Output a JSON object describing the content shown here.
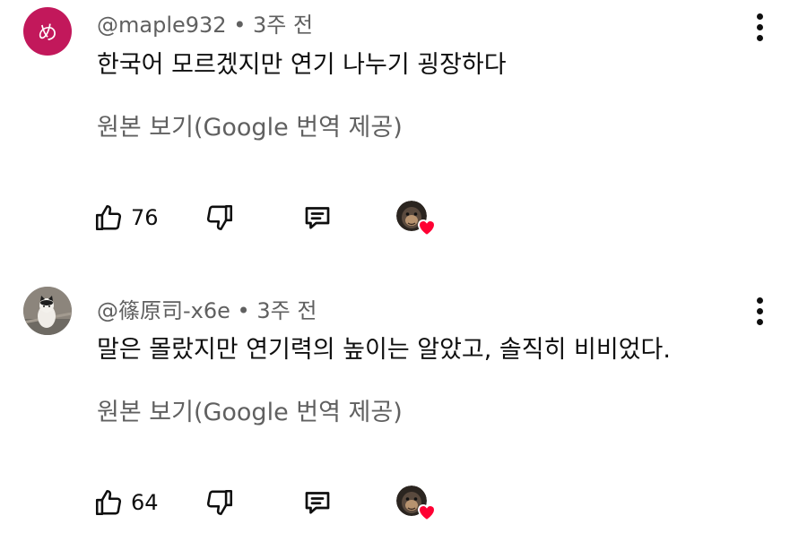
{
  "comments": [
    {
      "avatar_text": "め",
      "author": "@maple932",
      "separator": "•",
      "time": "3주 전",
      "text": "한국어 모르겠지만 연기 나누기 굉장하다",
      "translate_label": "원본 보기(Google 번역 제공)",
      "like_count": "76"
    },
    {
      "author": "@篠原司-x6e",
      "separator": "•",
      "time": "3주 전",
      "text": "말은 몰랐지만 연기력의 높이는 알았고, 솔직히 비비었다.",
      "translate_label": "원본 보기(Google 번역 제공)",
      "like_count": "64"
    }
  ],
  "colors": {
    "letter_avatar_bg": "#c2185b",
    "heart": "#ff0033",
    "secondary_text": "#606060"
  },
  "icons": [
    "thumbs-up-icon",
    "thumbs-down-icon",
    "reply-icon",
    "creator-heart-icon",
    "more-vert-icon"
  ]
}
